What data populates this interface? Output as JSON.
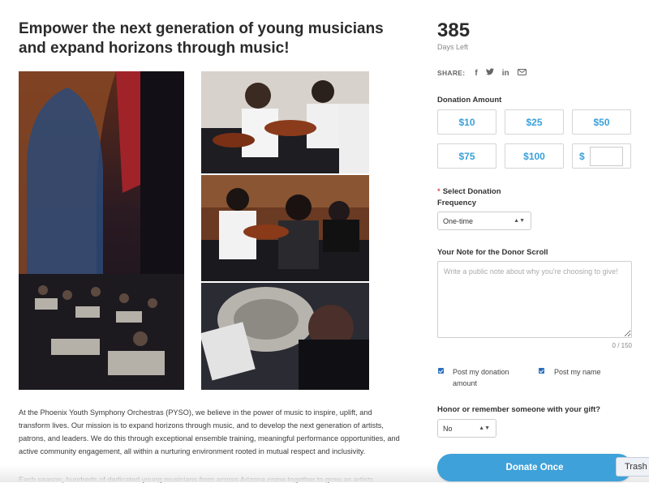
{
  "campaign": {
    "headline": "Empower the next generation of young musicians and expand horizons through music!",
    "description": "At the Phoenix Youth Symphony Orchestras (PYSO), we believe in the power of music to inspire, uplift, and transform lives. Our mission is to expand horizons through music, and to develop the next generation of artists, patrons, and leaders. We do this through exceptional ensemble training, meaningful performance opportunities, and active community engagement, all within a nurturing environment rooted in mutual respect and inclusivity.",
    "description_cutoff": "Each season, hundreds of dedicated young musicians from across Arizona come together to grow as artists"
  },
  "photos": [
    {
      "name": "orchestra-hall-photo",
      "icon": "orchestra-stage-image"
    },
    {
      "name": "violinists-photo",
      "icon": "violin-players-image"
    },
    {
      "name": "string-section-photo",
      "icon": "string-section-image"
    },
    {
      "name": "tuba-player-photo",
      "icon": "tuba-player-image"
    }
  ],
  "sidebar": {
    "days_left_number": "385",
    "days_left_label": "Days Left",
    "share_label": "SHARE:",
    "share_icons": [
      {
        "name": "facebook-icon",
        "glyph": "f"
      },
      {
        "name": "twitter-icon",
        "glyph": "🐦"
      },
      {
        "name": "linkedin-icon",
        "glyph": "in"
      },
      {
        "name": "email-icon",
        "glyph": "✉"
      }
    ],
    "donation_amount_label": "Donation Amount",
    "amounts": [
      "$10",
      "$25",
      "$50",
      "$75",
      "$100"
    ],
    "custom_amount_prefix": "$",
    "custom_amount_value": "",
    "frequency_label_required": "*",
    "frequency_label": "Select Donation Frequency",
    "frequency_value": "One-time",
    "note_label": "Your Note for the Donor Scroll",
    "note_placeholder": "Write a public note about why you're choosing to give!",
    "note_counter": "0 / 150",
    "checkbox_amount_label": "Post my donation amount",
    "checkbox_name_label": "Post my name",
    "honor_label": "Honor or remember someone with your gift?",
    "honor_value": "No",
    "donate_button": "Donate Once",
    "trash_label": "Trash"
  },
  "colors": {
    "accent": "#3ea1d9",
    "amount_text": "#3aa0da",
    "checkbox": "#2a6fbd",
    "required": "#d9534f"
  }
}
